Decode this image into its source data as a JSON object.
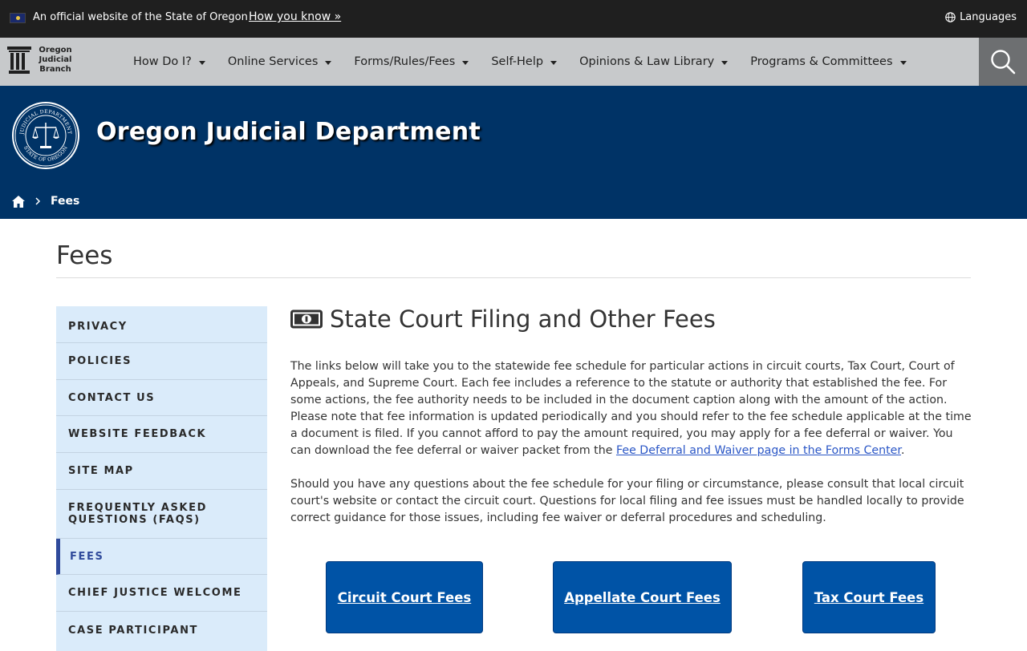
{
  "official_bar": {
    "text": "An official website of the State of Oregon",
    "how_you_know": "How you know »",
    "languages": "Languages"
  },
  "logo": {
    "line1": "Oregon",
    "line2": "Judicial",
    "line3": "Branch"
  },
  "nav": {
    "items": [
      {
        "label": "How Do I?"
      },
      {
        "label": "Online Services"
      },
      {
        "label": "Forms/Rules/Fees"
      },
      {
        "label": "Self-Help"
      },
      {
        "label": "Opinions & Law Library"
      },
      {
        "label": "Programs & Committees"
      }
    ]
  },
  "banner": {
    "title": "Oregon Judicial Department",
    "seal_top": "JUDICIAL DEPARTMENT",
    "seal_bottom": "STATE OF OREGON"
  },
  "breadcrumb": {
    "current": "Fees"
  },
  "page": {
    "title": "Fees"
  },
  "sidebar": {
    "items": [
      {
        "label": "PRIVACY",
        "active": false
      },
      {
        "label": "POLICIES",
        "active": false
      },
      {
        "label": "CONTACT US",
        "active": false
      },
      {
        "label": "WEBSITE FEEDBACK",
        "active": false
      },
      {
        "label": "SITE MAP",
        "active": false
      },
      {
        "label": "FREQUENTLY ASKED QUESTIONS (FAQS)",
        "active": false
      },
      {
        "label": "FEES",
        "active": true
      },
      {
        "label": "CHIEF JUSTICE WELCOME",
        "active": false
      },
      {
        "label": "CASE PARTICIPANT",
        "active": false
      }
    ]
  },
  "content": {
    "heading": "State Court Filing and Other Fees",
    "para1_text": "The links below will take you to the statewide fee schedule for particular actions in circuit courts, Tax Court, Court of Appeals, and Supreme Court.  Each fee includes a reference to the statute or authority that established the fee.  For some actions, the fee authority needs to be included in the document caption along with the amount of the action. Please note that fee information is updated periodically and you should refer to the fee schedule applicable at the time a document is filed. If you cannot afford to pay the amount required, you may apply for a fee deferral or waiver. You can download the fee deferral or waiver packet from the ",
    "para1_link": "Fee Deferral and Waiver page in the Forms Center",
    "para1_end": ".",
    "para2": "Should you have any questions about the fee schedule for your filing or circumstance, please consult that local circuit court's website or contact the circuit court.  Questions for local filing and fee issues must be handled locally to provide correct guidance for those issues, including fee waiver or deferral procedures and scheduling."
  },
  "buttons": {
    "circuit": "Circuit Court Fees",
    "appellate": "Appellate Court Fees",
    "tax": "Tax Court Fees"
  },
  "colors": {
    "official_bar": "#1f1f1f",
    "nav_bar": "#c7c9cb",
    "banner": "#003366",
    "sidebar": "#daebfa",
    "button": "#0053a6",
    "active_accent": "#2f4a9b"
  }
}
